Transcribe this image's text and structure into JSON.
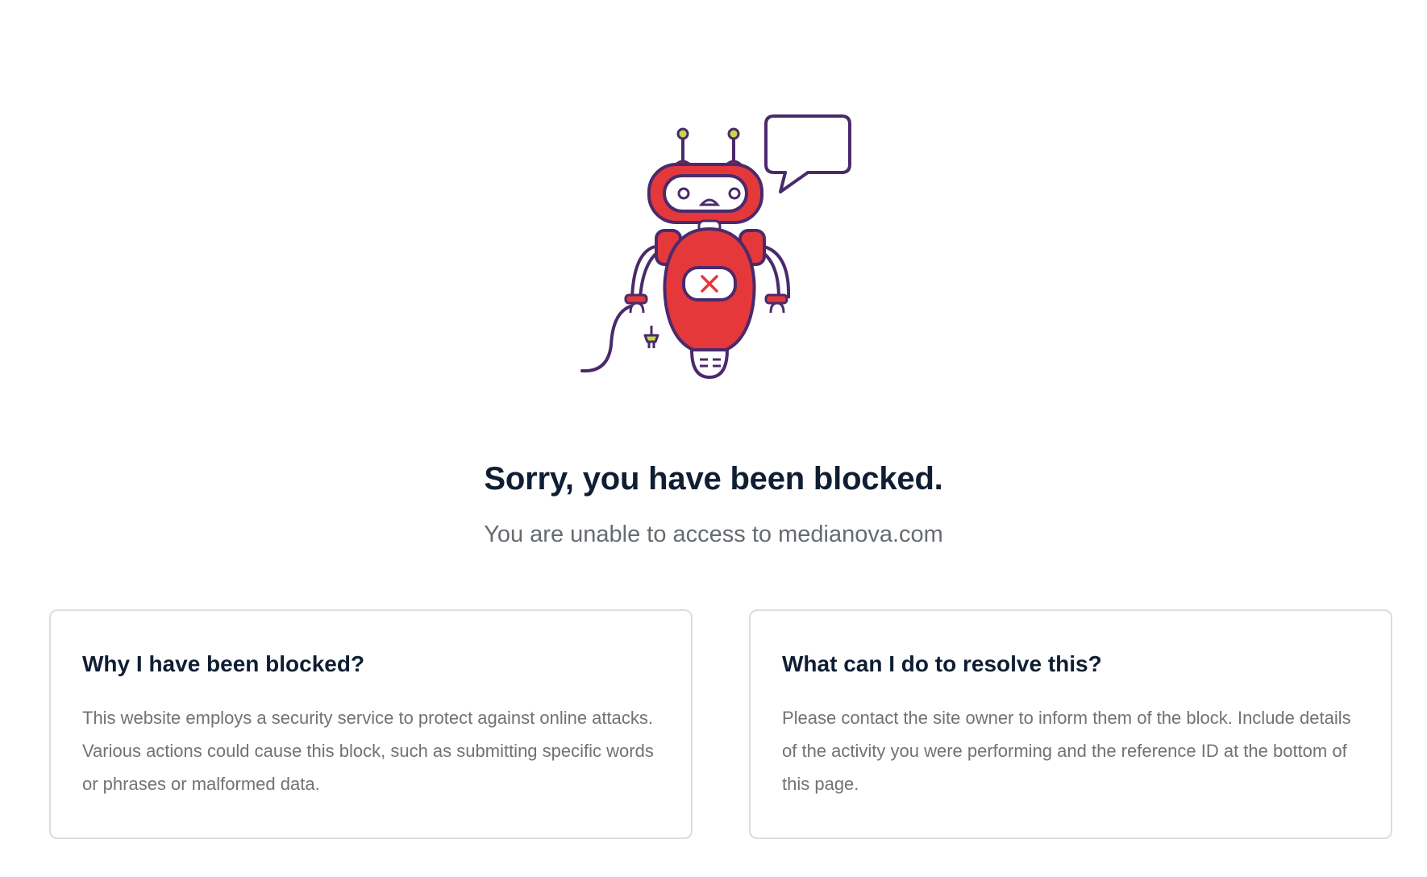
{
  "page": {
    "headline": "Sorry, you have been blocked.",
    "subline": "You are unable to access to medianova.com"
  },
  "illustration": {
    "name": "blocked-robot",
    "colors": {
      "body": "#e5383b",
      "outline": "#4b2a6b",
      "accent": "#c6d84a"
    }
  },
  "cards": [
    {
      "title": "Why I have been blocked?",
      "body": "This website employs a security service to protect against online attacks. Various actions could cause this block, such as submitting specific words or phrases or malformed data."
    },
    {
      "title": "What can I do to resolve this?",
      "body": "Please contact the site owner to inform them of the block. Include details of the activity you were performing and the reference ID at the bottom of this page."
    }
  ]
}
